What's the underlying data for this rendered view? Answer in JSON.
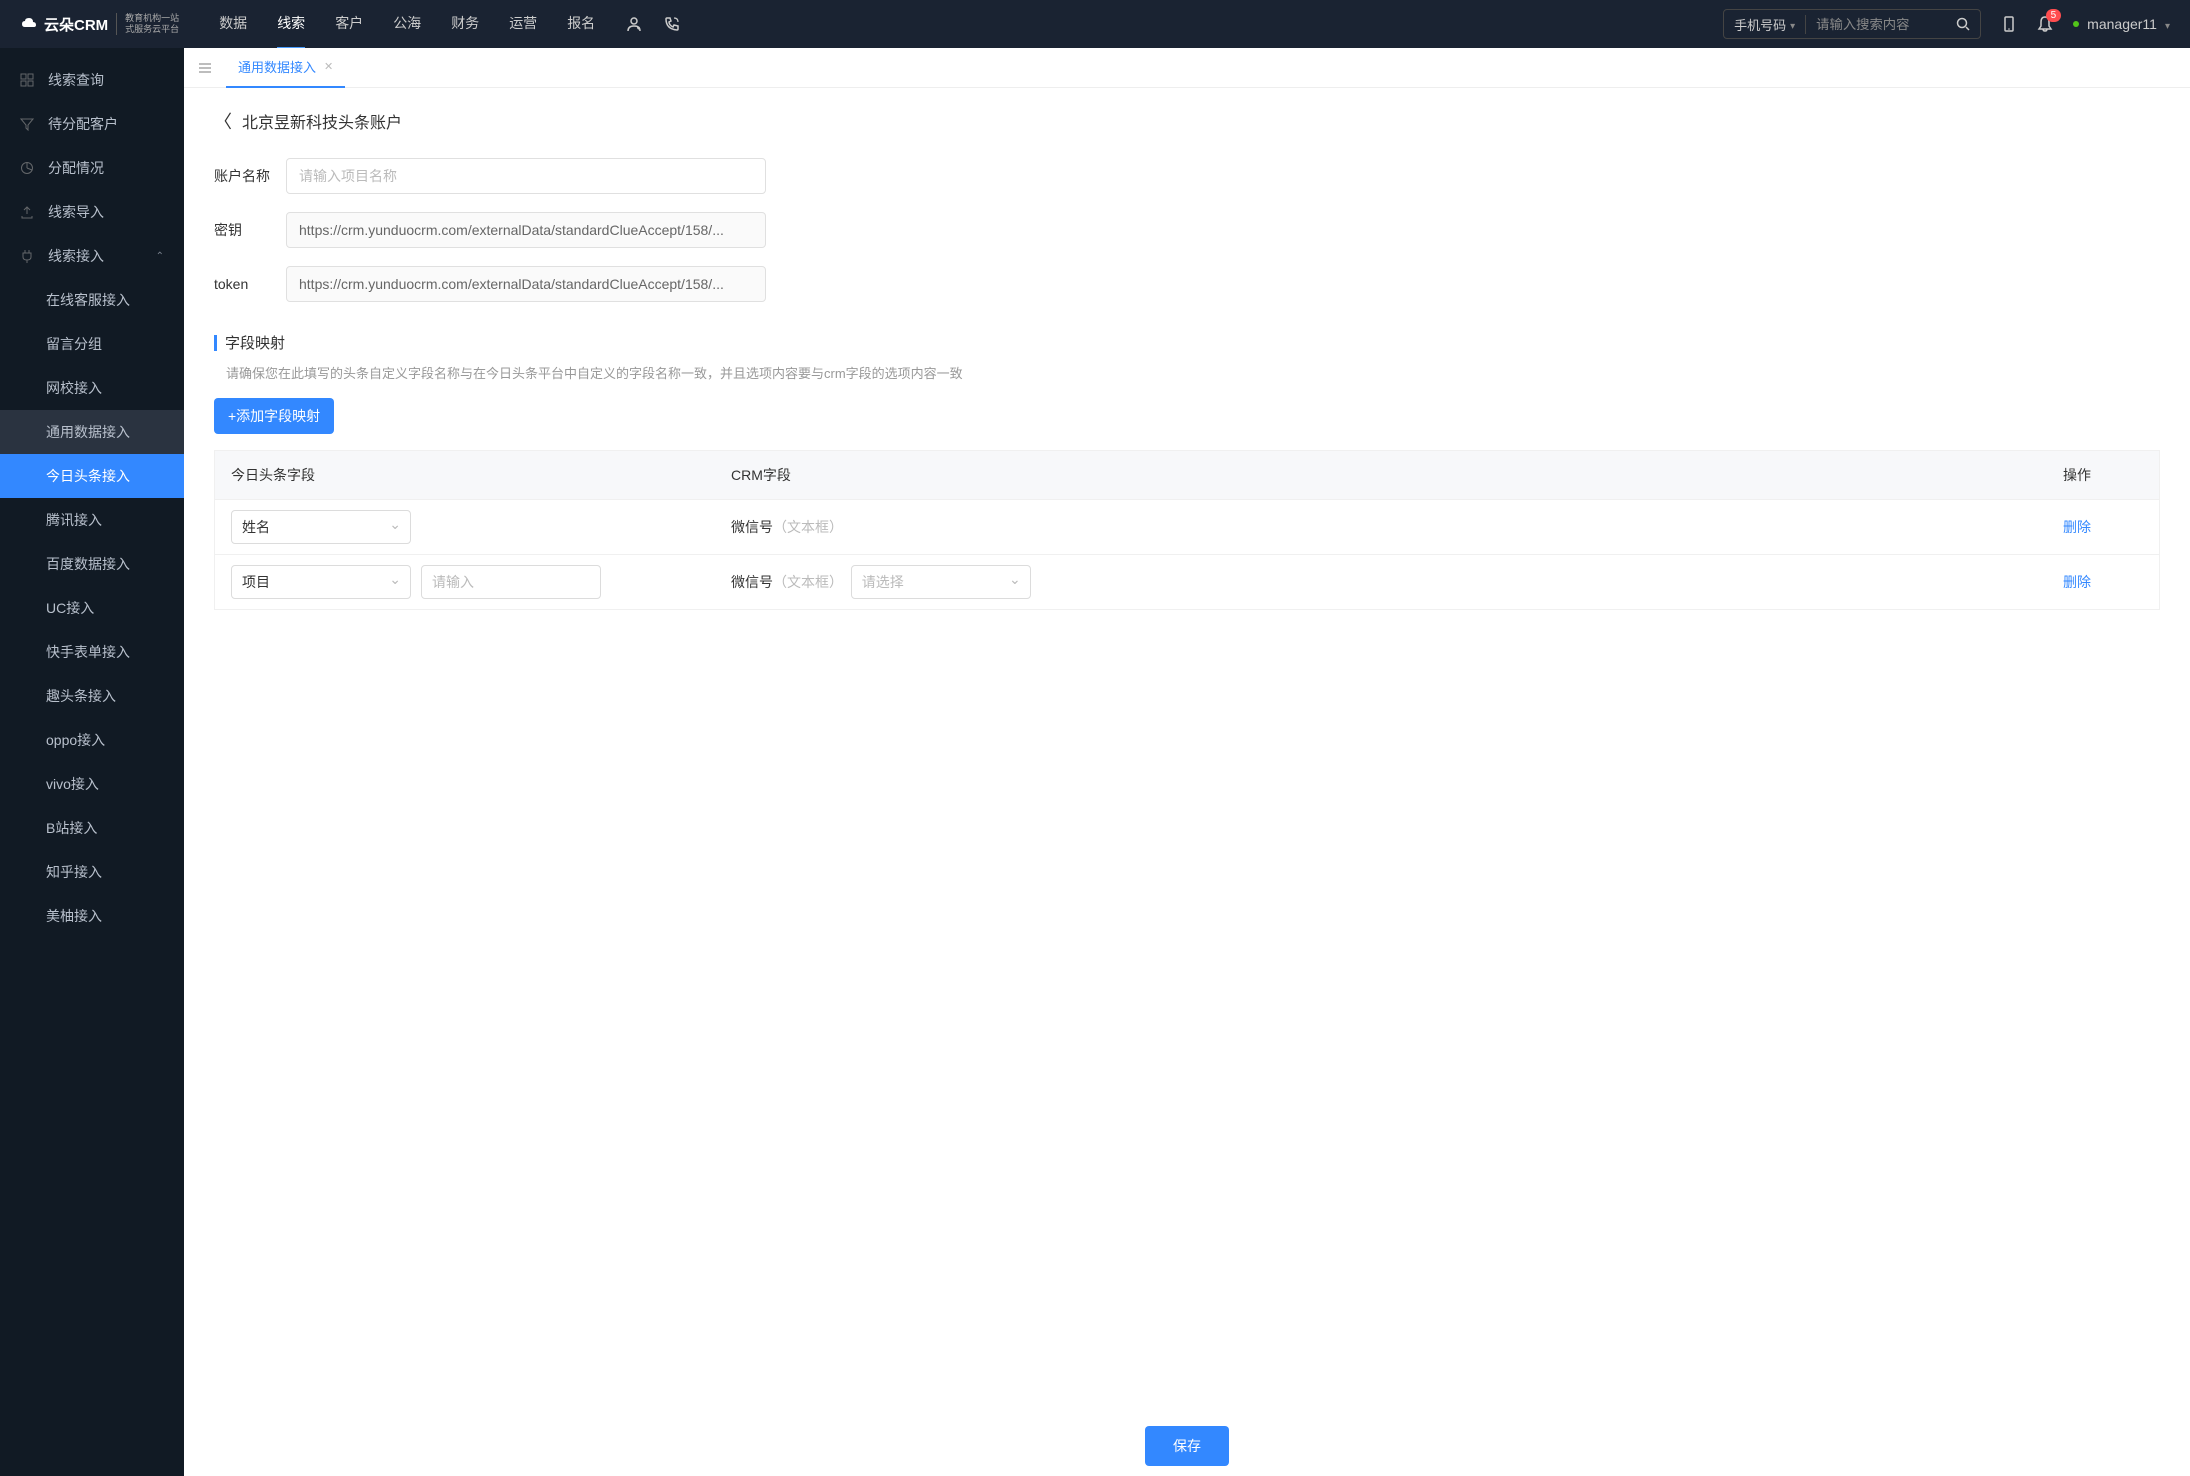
{
  "header": {
    "logo_main": "云朵CRM",
    "logo_sub_1": "教育机构一站",
    "logo_sub_2": "式服务云平台",
    "nav": [
      "数据",
      "线索",
      "客户",
      "公海",
      "财务",
      "运营",
      "报名"
    ],
    "nav_active_index": 1,
    "search_type": "手机号码",
    "search_placeholder": "请输入搜索内容",
    "notif_count": "5",
    "username": "manager11"
  },
  "sidebar": {
    "items": [
      {
        "label": "线索查询",
        "icon": "grid"
      },
      {
        "label": "待分配客户",
        "icon": "filter"
      },
      {
        "label": "分配情况",
        "icon": "pie"
      },
      {
        "label": "线索导入",
        "icon": "upload"
      },
      {
        "label": "线索接入",
        "icon": "plug",
        "expanded": true
      }
    ],
    "sub_items": [
      {
        "label": "在线客服接入"
      },
      {
        "label": "留言分组"
      },
      {
        "label": "网校接入"
      },
      {
        "label": "通用数据接入",
        "highlighted": true
      },
      {
        "label": "今日头条接入",
        "active": true
      },
      {
        "label": "腾讯接入"
      },
      {
        "label": "百度数据接入"
      },
      {
        "label": "UC接入"
      },
      {
        "label": "快手表单接入"
      },
      {
        "label": "趣头条接入"
      },
      {
        "label": "oppo接入"
      },
      {
        "label": "vivo接入"
      },
      {
        "label": "B站接入"
      },
      {
        "label": "知乎接入"
      },
      {
        "label": "美柚接入"
      }
    ]
  },
  "tabs": {
    "current": "通用数据接入"
  },
  "page": {
    "back_title": "北京昱新科技头条账户",
    "form": {
      "account_label": "账户名称",
      "account_placeholder": "请输入项目名称",
      "secret_label": "密钥",
      "secret_value": "https://crm.yunduocrm.com/externalData/standardClueAccept/158/...",
      "token_label": "token",
      "token_value": "https://crm.yunduocrm.com/externalData/standardClueAccept/158/..."
    },
    "section": {
      "title": "字段映射",
      "tip": "请确保您在此填写的头条自定义字段名称与在今日头条平台中自定义的字段名称一致，并且选项内容要与crm字段的选项内容一致",
      "add_button": "+添加字段映射"
    },
    "table": {
      "headers": [
        "今日头条字段",
        "CRM字段",
        "操作"
      ],
      "rows": [
        {
          "tt_field": "姓名",
          "extra_input": false,
          "crm_field": "微信号",
          "crm_type": "（文本框）",
          "crm_select": false,
          "action": "删除"
        },
        {
          "tt_field": "项目",
          "extra_input": true,
          "extra_placeholder": "请输入",
          "crm_field": "微信号",
          "crm_type": "（文本框）",
          "crm_select": true,
          "crm_select_placeholder": "请选择",
          "action": "删除"
        }
      ]
    },
    "save_button": "保存"
  }
}
